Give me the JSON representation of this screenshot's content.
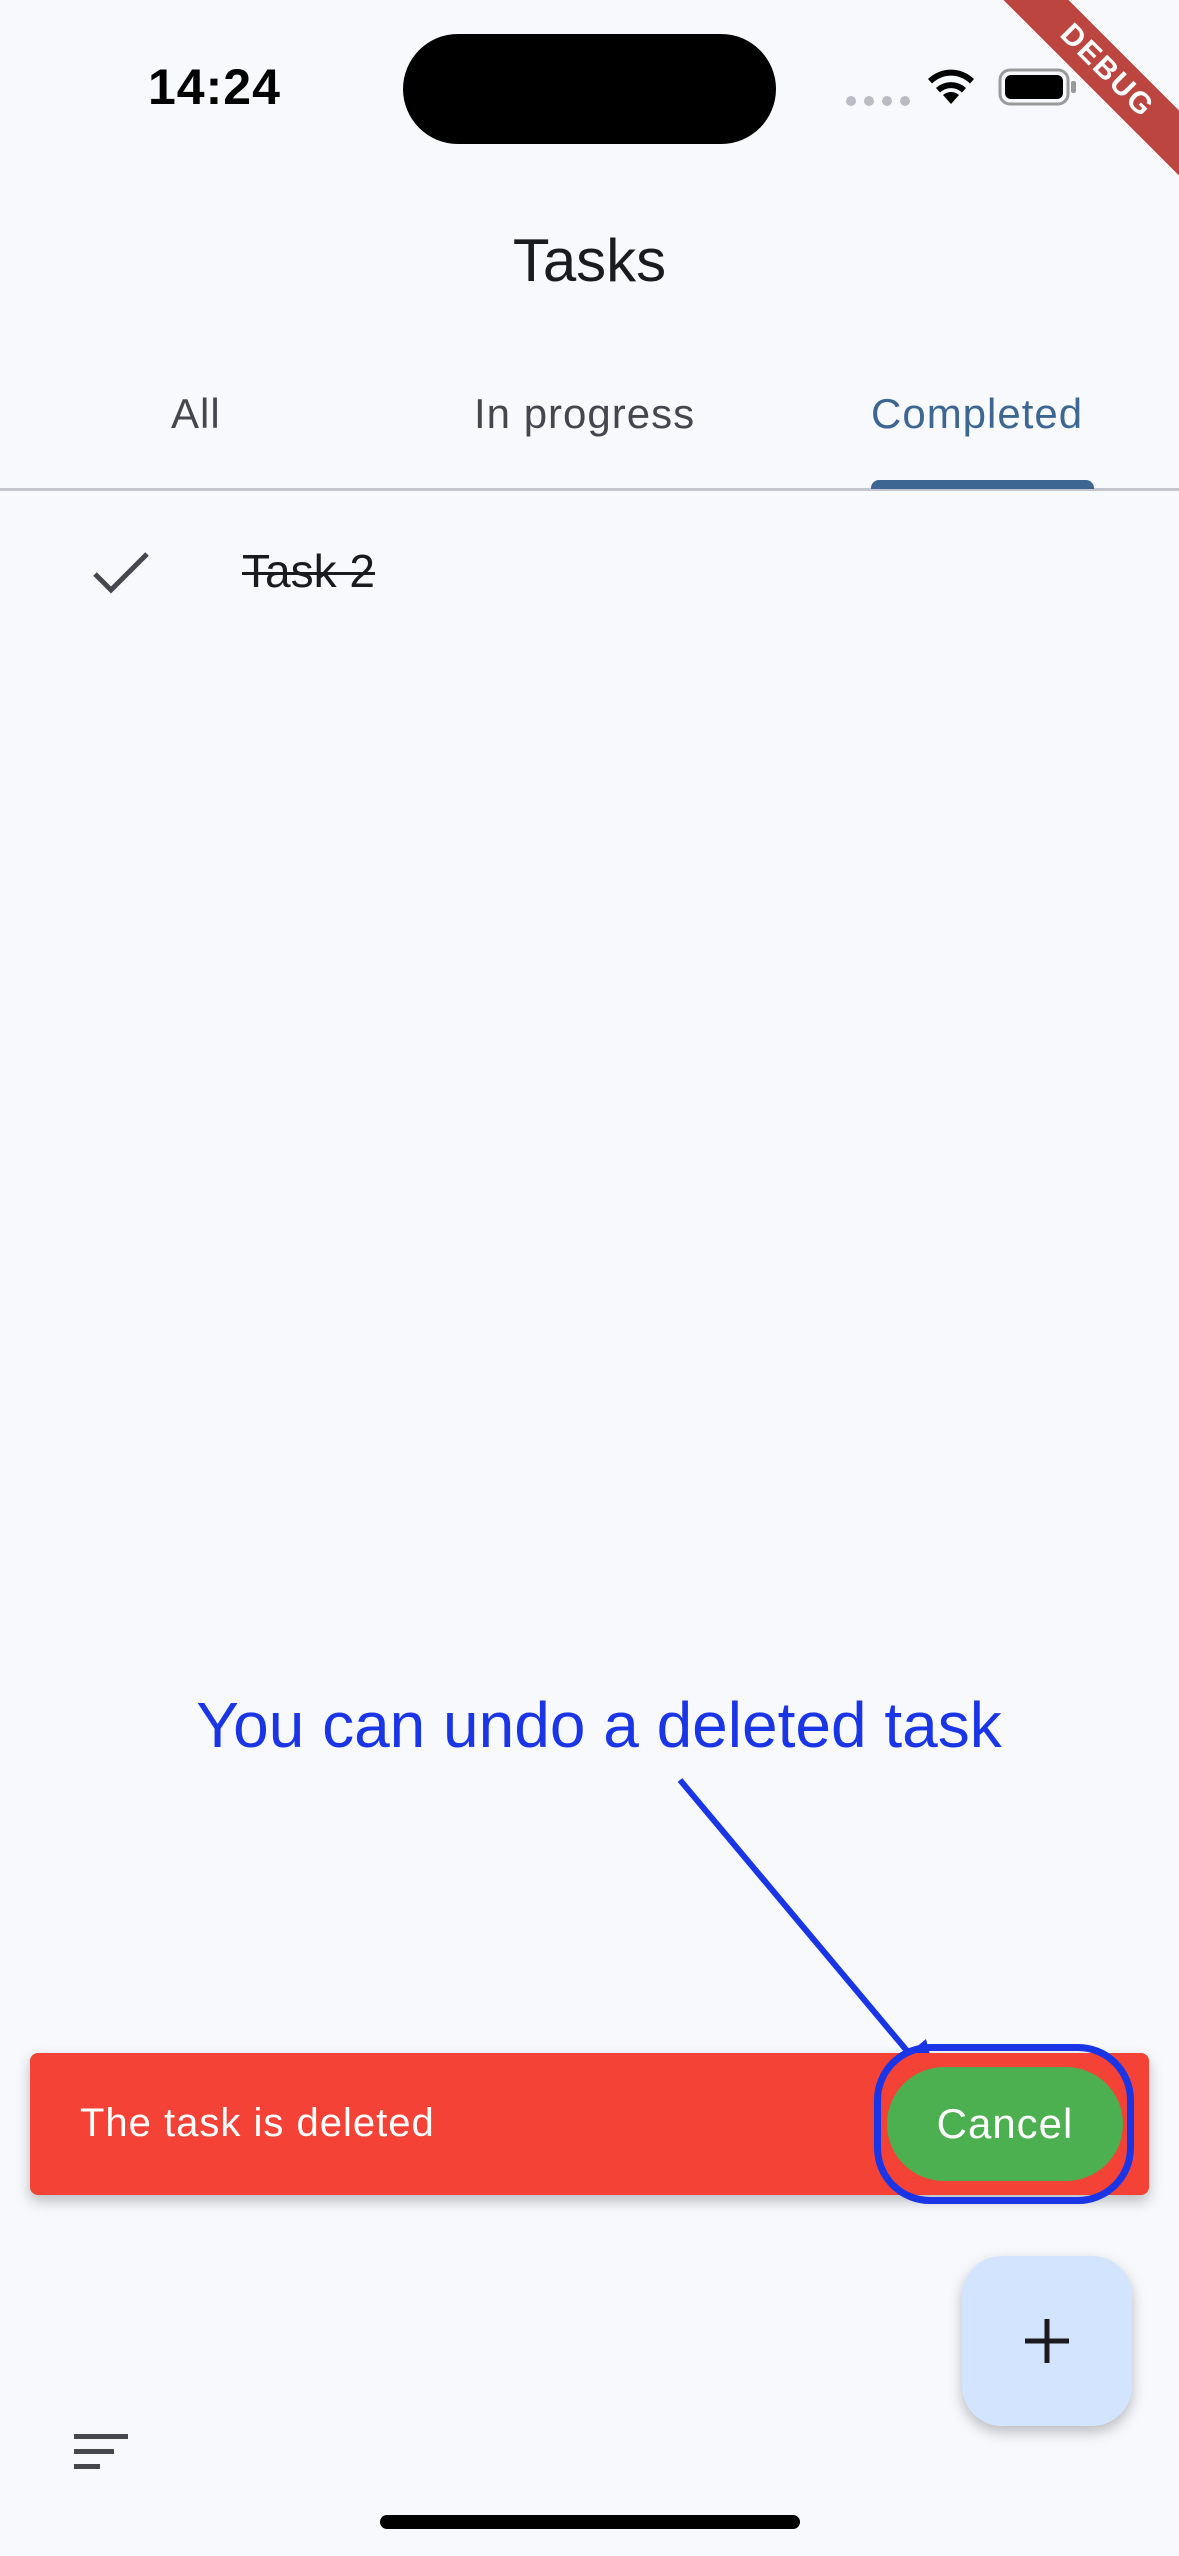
{
  "status_bar": {
    "time": "14:24"
  },
  "debug_banner": "DEBUG",
  "app_bar": {
    "title": "Tasks"
  },
  "tabs": [
    {
      "label": "All",
      "selected": false
    },
    {
      "label": "In progress",
      "selected": false
    },
    {
      "label": "Completed",
      "selected": true
    }
  ],
  "tasks": [
    {
      "label": "Task 2",
      "completed": true,
      "icon": "check-icon"
    }
  ],
  "annotation": {
    "text": "You can undo a deleted task",
    "color": "#1a35e6"
  },
  "snackbar": {
    "message": "The task is deleted",
    "action_label": "Cancel",
    "background": "#f44336",
    "action_background": "#4caf50"
  },
  "fab": {
    "icon": "plus-icon",
    "background": "#d3e4ff"
  },
  "bottom": {
    "sort_icon": "sort-icon"
  },
  "colors": {
    "accent": "#3d6792",
    "background": "#F7F9FD"
  }
}
